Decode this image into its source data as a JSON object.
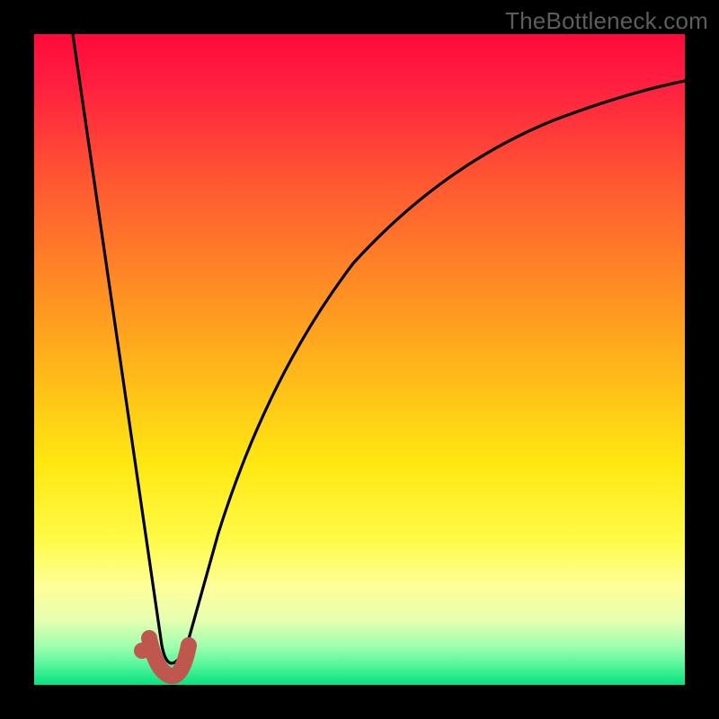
{
  "watermark": "TheBottleneck.com",
  "chart_data": {
    "type": "line",
    "title": "",
    "xlabel": "",
    "ylabel": "",
    "xlim": [
      0,
      100
    ],
    "ylim": [
      0,
      100
    ],
    "grid": false,
    "legend": false,
    "series": [
      {
        "name": "bottleneck-curve",
        "x": [
          6,
          10,
          14,
          17,
          18.5,
          20,
          22,
          26,
          31,
          37,
          44,
          52,
          62,
          74,
          88,
          100
        ],
        "values": [
          100,
          73,
          45,
          21,
          8,
          2,
          8,
          25,
          44,
          58,
          69,
          77,
          83,
          88,
          91,
          93
        ]
      },
      {
        "name": "recommended-range",
        "x": [
          17.5,
          18.0,
          18.8,
          20.0,
          21.5,
          22.5
        ],
        "values": [
          7.5,
          4.5,
          1.8,
          1.0,
          2.0,
          5.0
        ]
      },
      {
        "name": "optimal-point",
        "x": [
          16.5
        ],
        "values": [
          5.5
        ]
      }
    ],
    "colors": {
      "curve": "#000000",
      "marker": "#c0574f"
    }
  }
}
